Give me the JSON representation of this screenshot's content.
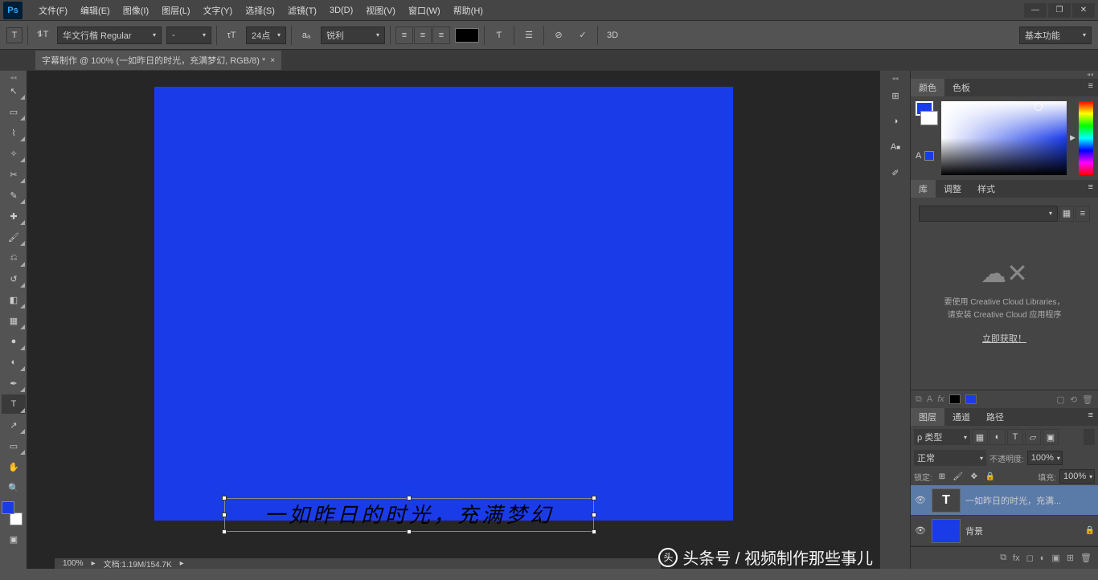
{
  "app": {
    "logo": "Ps"
  },
  "menu": [
    "文件(F)",
    "编辑(E)",
    "图像(I)",
    "图层(L)",
    "文字(Y)",
    "选择(S)",
    "滤镜(T)",
    "3D(D)",
    "视图(V)",
    "窗口(W)",
    "帮助(H)"
  ],
  "options": {
    "tool_glyph": "T",
    "orientation_glyph": "⟂T",
    "font_family": "华文行楷 Regular",
    "font_style": "-",
    "size_icon": "τT",
    "font_size": "24点",
    "aa_label": "aₐ",
    "aa_mode": "锐利",
    "commit": "✓",
    "cancel": "⊘",
    "threed": "3D",
    "workspace": "基本功能"
  },
  "tab": {
    "title": "字幕制作 @ 100% (一如昨日的时光，充满梦幻, RGB/8) *",
    "close": "×"
  },
  "canvas": {
    "text": "一如昨日的时光，充满梦幻"
  },
  "panels": {
    "color": {
      "tabs": [
        "颜色",
        "色板"
      ],
      "mode_label": "A"
    },
    "library": {
      "tabs": [
        "库",
        "调整",
        "样式"
      ],
      "line1": "要使用 Creative Cloud Libraries，",
      "line2": "请安装 Creative Cloud 应用程序",
      "link": "立即获取！"
    },
    "layers": {
      "tabs": [
        "图层",
        "通道",
        "路径"
      ],
      "filter_label": "ρ 类型",
      "blend_mode": "正常",
      "opacity_label": "不透明度:",
      "opacity_value": "100%",
      "lock_label": "锁定:",
      "fill_label": "填充:",
      "fill_value": "100%",
      "rows": [
        {
          "thumb": "T",
          "name": "一如昨日的时光，充满..."
        },
        {
          "thumb": "bg",
          "name": "背景"
        }
      ]
    }
  },
  "status": {
    "zoom": "100%",
    "docinfo": "文档:1.19M/154.7K"
  },
  "watermark": "头条号 / 视频制作那些事儿",
  "icons": {
    "move": "↖",
    "marquee": "▭",
    "lasso": "⌇",
    "wand": "✧",
    "crop": "✂",
    "eyedrop": "✎",
    "heal": "✚",
    "brush": "🖌",
    "stamp": "⎌",
    "history": "↺",
    "eraser": "◧",
    "gradient": "▦",
    "blur": "●",
    "dodge": "◐",
    "pen": "✒",
    "type": "T",
    "path": "↗",
    "shape": "▭",
    "hand": "✋",
    "zoom": "🔍",
    "quickmask": "▣",
    "char": "⊞",
    "para": "¶",
    "glyph": "Ǎ",
    "brush2": "✐",
    "adjust": "◑"
  }
}
